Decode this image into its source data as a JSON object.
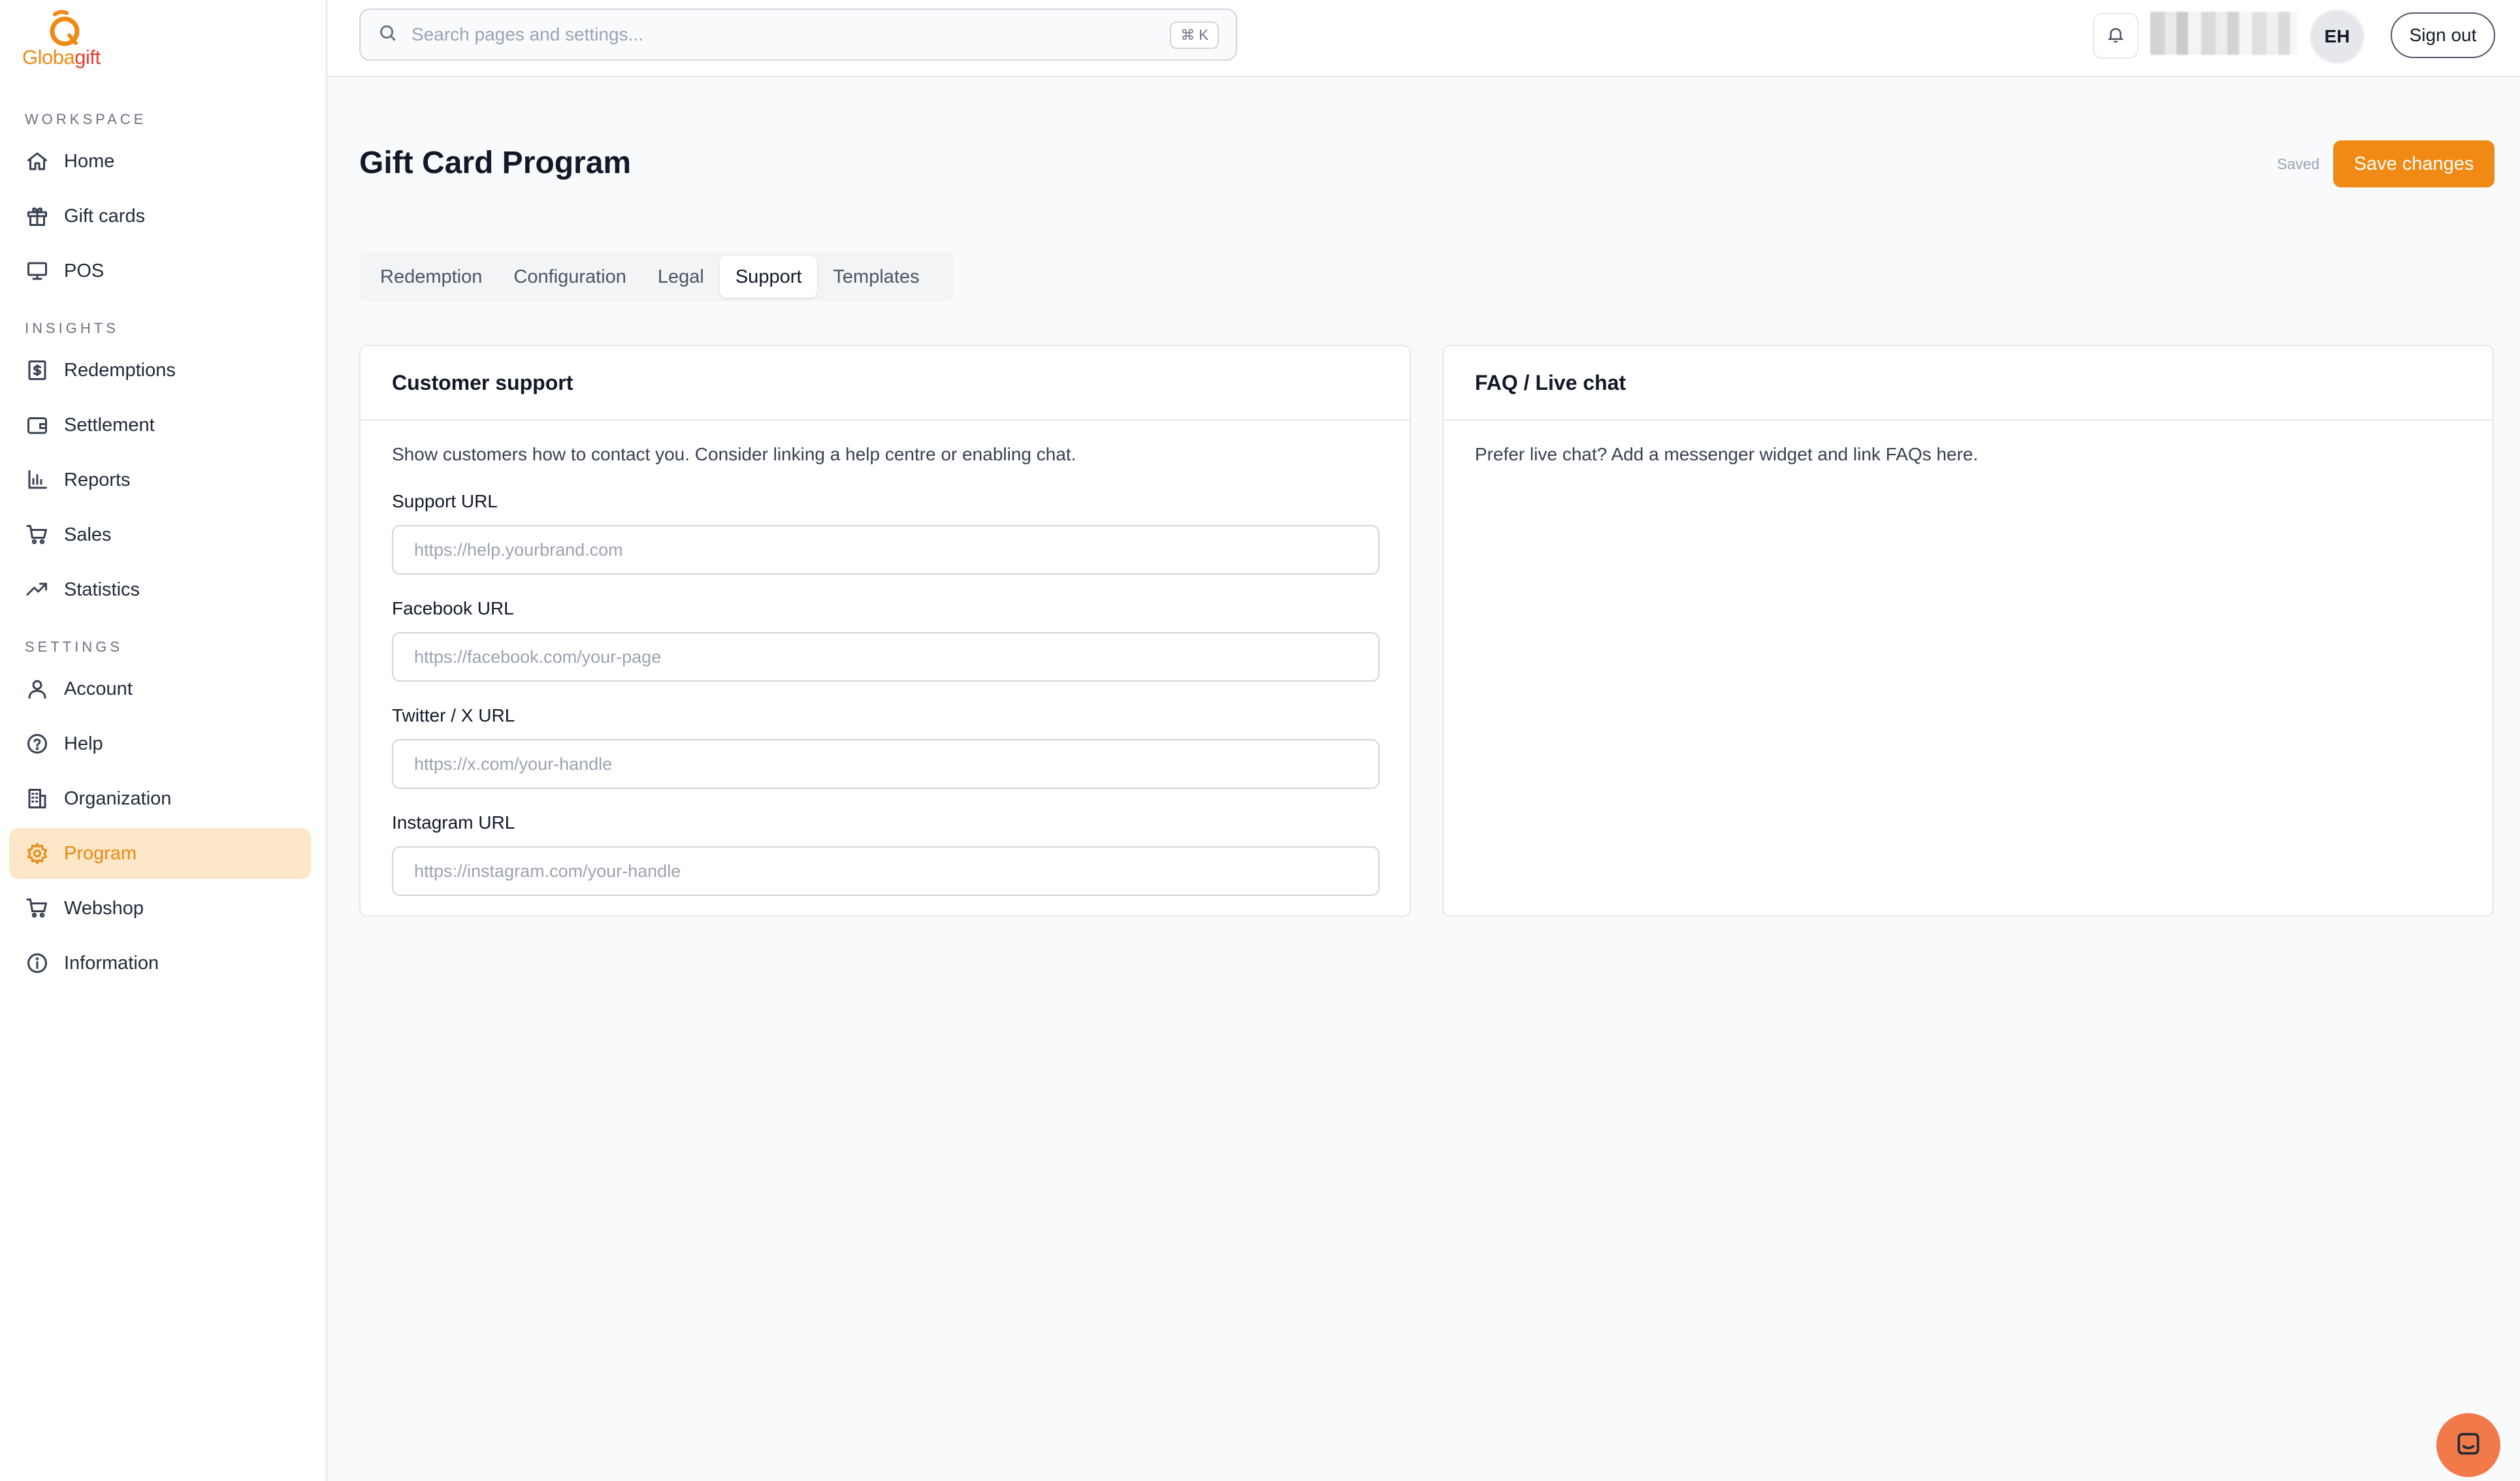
{
  "brand": {
    "name_part1": "Globa",
    "name_part2": "gift",
    "colors": {
      "accent": "#f08a14",
      "accent_soft": "#fde7c9",
      "chat": "#f2794a"
    }
  },
  "sidebar": {
    "sections": [
      {
        "label": "WORKSPACE",
        "items": [
          {
            "label": "Home",
            "icon": "home-icon"
          },
          {
            "label": "Gift cards",
            "icon": "gift-icon"
          },
          {
            "label": "POS",
            "icon": "monitor-icon"
          }
        ]
      },
      {
        "label": "INSIGHTS",
        "items": [
          {
            "label": "Redemptions",
            "icon": "receipt-icon"
          },
          {
            "label": "Settlement",
            "icon": "wallet-icon"
          },
          {
            "label": "Reports",
            "icon": "bar-chart-icon"
          },
          {
            "label": "Sales",
            "icon": "cart-icon"
          },
          {
            "label": "Statistics",
            "icon": "trend-icon"
          }
        ]
      },
      {
        "label": "SETTINGS",
        "items": [
          {
            "label": "Account",
            "icon": "user-icon"
          },
          {
            "label": "Help",
            "icon": "help-circle-icon"
          },
          {
            "label": "Organization",
            "icon": "building-icon"
          },
          {
            "label": "Program",
            "icon": "gear-icon",
            "active": true
          },
          {
            "label": "Webshop",
            "icon": "cart-icon"
          },
          {
            "label": "Information",
            "icon": "info-icon"
          }
        ]
      }
    ]
  },
  "topbar": {
    "search_placeholder": "Search pages and settings...",
    "search_shortcut": "⌘ K",
    "avatar_initials": "EH",
    "sign_out_label": "Sign out"
  },
  "header": {
    "title": "Gift Card Program",
    "status": "Saved",
    "save_label": "Save changes"
  },
  "tabs": [
    {
      "label": "Redemption"
    },
    {
      "label": "Configuration"
    },
    {
      "label": "Legal"
    },
    {
      "label": "Support",
      "active": true
    },
    {
      "label": "Templates"
    }
  ],
  "support_card": {
    "title": "Customer support",
    "description": "Show customers how to contact you. Consider linking a help centre or enabling chat.",
    "fields": [
      {
        "label": "Support URL",
        "placeholder": "https://help.yourbrand.com",
        "value": ""
      },
      {
        "label": "Facebook URL",
        "placeholder": "https://facebook.com/your-page",
        "value": ""
      },
      {
        "label": "Twitter / X URL",
        "placeholder": "https://x.com/your-handle",
        "value": ""
      },
      {
        "label": "Instagram URL",
        "placeholder": "https://instagram.com/your-handle",
        "value": ""
      }
    ]
  },
  "faq_card": {
    "title": "FAQ / Live chat",
    "description": "Prefer live chat? Add a messenger widget and link FAQs here."
  }
}
